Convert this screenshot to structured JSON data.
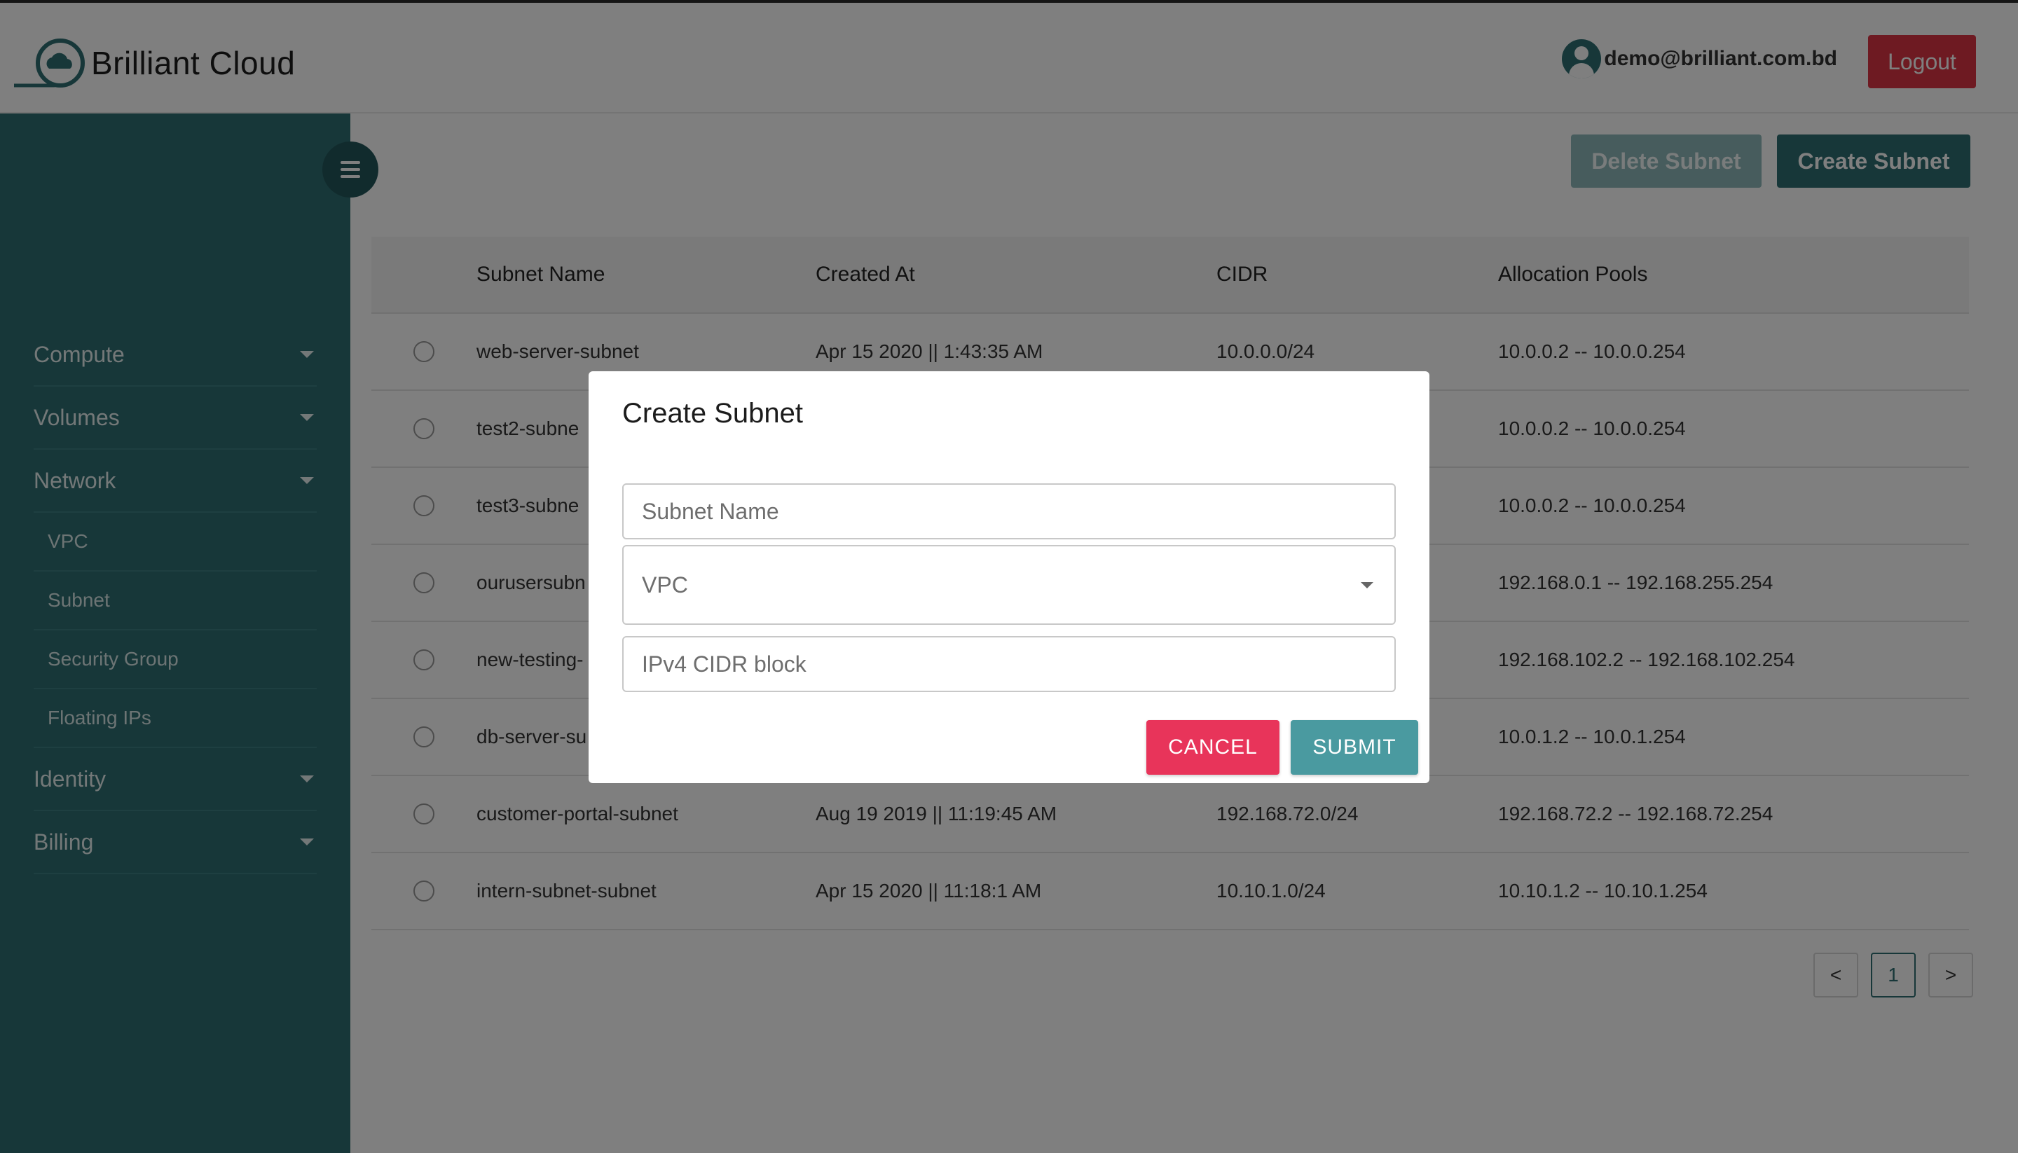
{
  "header": {
    "brand": "Brilliant Cloud",
    "user_email": "demo@brilliant.com.bd",
    "logout_label": "Logout"
  },
  "sidebar": {
    "items": [
      {
        "label": "Compute",
        "icon": "chevron-down-icon"
      },
      {
        "label": "Volumes",
        "icon": "chevron-down-icon"
      },
      {
        "label": "Network",
        "icon": "chevron-down-icon"
      },
      {
        "label": "Identity",
        "icon": "chevron-down-icon"
      },
      {
        "label": "Billing",
        "icon": "chevron-down-icon"
      }
    ],
    "network_sub": [
      "VPC",
      "Subnet",
      "Security Group",
      "Floating IPs"
    ]
  },
  "toolbar": {
    "delete_label": "Delete Subnet",
    "create_label": "Create Subnet"
  },
  "table": {
    "headers": [
      "Subnet Name",
      "Created At",
      "CIDR",
      "Allocation Pools"
    ],
    "rows": [
      [
        "web-server-subnet",
        "Apr 15 2020 || 1:43:35 AM",
        "10.0.0.0/24",
        "10.0.0.2 -- 10.0.0.254"
      ],
      [
        "test2-subne",
        "",
        "",
        "10.0.0.2 -- 10.0.0.254"
      ],
      [
        "test3-subne",
        "",
        "",
        "10.0.0.2 -- 10.0.0.254"
      ],
      [
        "ourusersubn",
        "",
        "",
        "192.168.0.1 -- 192.168.255.254"
      ],
      [
        "new-testing-",
        "",
        "",
        "192.168.102.2 -- 192.168.102.254"
      ],
      [
        "db-server-su",
        "",
        "",
        "10.0.1.2 -- 10.0.1.254"
      ],
      [
        "customer-portal-subnet",
        "Aug 19 2019 || 11:19:45 AM",
        "192.168.72.0/24",
        "192.168.72.2 -- 192.168.72.254"
      ],
      [
        "intern-subnet-subnet",
        "Apr 15 2020 || 11:18:1 AM",
        "10.10.1.0/24",
        "10.10.1.2 -- 10.10.1.254"
      ]
    ]
  },
  "pagination": {
    "prev": "<",
    "current": "1",
    "next": ">"
  },
  "modal": {
    "title": "Create Subnet",
    "name_placeholder": "Subnet Name",
    "vpc_placeholder": "VPC",
    "cidr_placeholder": "IPv4 CIDR block",
    "cancel_label": "CANCEL",
    "submit_label": "SUBMIT"
  },
  "colors": {
    "sidebar": "#2f6f73",
    "logout": "#dc3545",
    "cancel": "#e8345a",
    "submit": "#4a9aa0"
  }
}
